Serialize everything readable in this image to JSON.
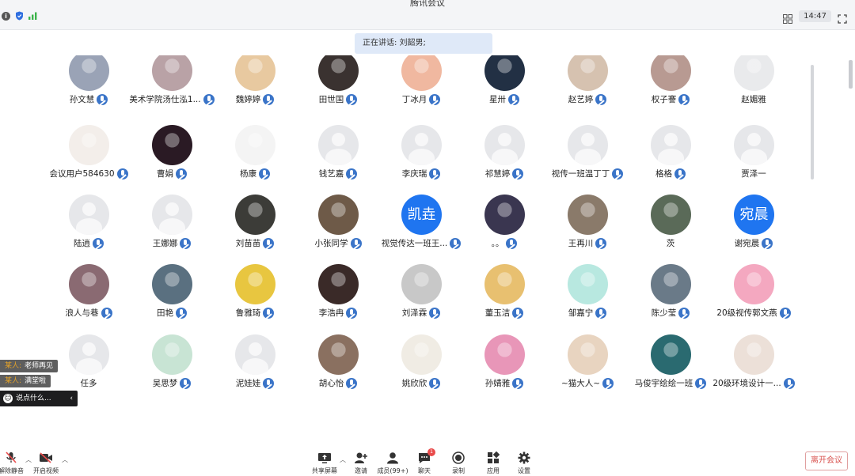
{
  "app": {
    "title": "腾讯会议",
    "time": "14:47",
    "info_icon": "i"
  },
  "speaking": {
    "text": "正在讲话: 刘韶男;"
  },
  "participants": [
    {
      "name": "孙文慧",
      "avatar": "photo",
      "color": "#9aa3b6"
    },
    {
      "name": "美术学院汤仕泓1...",
      "avatar": "photo",
      "color": "#b9a2a6"
    },
    {
      "name": "魏婷婷",
      "avatar": "photo",
      "color": "#e8c9a0"
    },
    {
      "name": "田世国",
      "avatar": "photo",
      "color": "#3a3230"
    },
    {
      "name": "丁冰月",
      "avatar": "photo",
      "color": "#f0b8a0"
    },
    {
      "name": "星卅",
      "avatar": "photo",
      "color": "#223044"
    },
    {
      "name": "赵艺婷",
      "avatar": "photo",
      "color": "#d6c2b0"
    },
    {
      "name": "权子謇",
      "avatar": "photo",
      "color": "#b89a92"
    },
    {
      "name": "赵媚雅",
      "avatar": "photo",
      "color": "#e9eaec"
    },
    {
      "name": "会议用户584630",
      "avatar": "photo",
      "color": "#f3eeea"
    },
    {
      "name": "曹娟",
      "avatar": "photo",
      "color": "#2a1a24"
    },
    {
      "name": "杨康",
      "avatar": "photo",
      "color": "#f4f4f4"
    },
    {
      "name": "钱艺嘉",
      "avatar": "blank"
    },
    {
      "name": "李庆瑞",
      "avatar": "blank"
    },
    {
      "name": "祁慧婷",
      "avatar": "blank"
    },
    {
      "name": "视传一班温丁丁",
      "avatar": "blank"
    },
    {
      "name": "格格",
      "avatar": "blank"
    },
    {
      "name": "贾泽一",
      "avatar": "blank"
    },
    {
      "name": "陆逍",
      "avatar": "blank"
    },
    {
      "name": "王娜娜",
      "avatar": "blank"
    },
    {
      "name": "刘苗苗",
      "avatar": "photo",
      "color": "#3c3c38"
    },
    {
      "name": "小张同学",
      "avatar": "photo",
      "color": "#6e5a48"
    },
    {
      "name": "视觉传达一班王...",
      "avatar": "text",
      "text": "凯垚"
    },
    {
      "name": "。。",
      "avatar": "photo",
      "color": "#3a3650"
    },
    {
      "name": "王再川",
      "avatar": "photo",
      "color": "#8a7a6a"
    },
    {
      "name": "茨",
      "avatar": "photo",
      "color": "#5a6a58"
    },
    {
      "name": "谢宛晨",
      "avatar": "text",
      "text": "宛晨"
    },
    {
      "name": "浪人与巷",
      "avatar": "photo",
      "color": "#8a6a72"
    },
    {
      "name": "田艳",
      "avatar": "photo",
      "color": "#5a7080"
    },
    {
      "name": "鲁雅琦",
      "avatar": "photo",
      "color": "#e8c640"
    },
    {
      "name": "李浩冉",
      "avatar": "photo",
      "color": "#3a2a28"
    },
    {
      "name": "刘泽霖",
      "avatar": "photo",
      "color": "#c8c8c8"
    },
    {
      "name": "董玉洁",
      "avatar": "photo",
      "color": "#e8c070"
    },
    {
      "name": "邹嘉宁",
      "avatar": "photo",
      "color": "#b8e8e0"
    },
    {
      "name": "陈少莹",
      "avatar": "photo",
      "color": "#6a7a88"
    },
    {
      "name": "20级视传郭文燕",
      "avatar": "photo",
      "color": "#f4a8c0"
    },
    {
      "name": "任多",
      "avatar": "blank"
    },
    {
      "name": "吴思梦",
      "avatar": "photo",
      "color": "#c8e4d4"
    },
    {
      "name": "泥娃娃",
      "avatar": "blank"
    },
    {
      "name": "胡心怡",
      "avatar": "photo",
      "color": "#8a7060"
    },
    {
      "name": "姚欣欣",
      "avatar": "photo",
      "color": "#f0ece4"
    },
    {
      "name": "孙婧雅",
      "avatar": "photo",
      "color": "#e896b8"
    },
    {
      "name": "~猫大人~",
      "avatar": "photo",
      "color": "#e8d4c0"
    },
    {
      "name": "马俊宇绘绘一班",
      "avatar": "photo",
      "color": "#2a6a70"
    },
    {
      "name": "20级环境设计一...",
      "avatar": "photo",
      "color": "#ece0d8"
    }
  ],
  "chat": {
    "messages": [
      {
        "who": "某人:",
        "text": "老师再见"
      },
      {
        "who": "某人:",
        "text": "满堂啦"
      }
    ],
    "input_placeholder": "说点什么..."
  },
  "toolbar": {
    "unmute": "解除静音",
    "start_video": "开启视频",
    "share_screen": "共享屏幕",
    "invite": "邀请",
    "members": "成员(99+)",
    "chat": "聊天",
    "chat_badge": "1",
    "record": "录制",
    "apps": "应用",
    "settings": "设置",
    "leave": "离开会议"
  }
}
